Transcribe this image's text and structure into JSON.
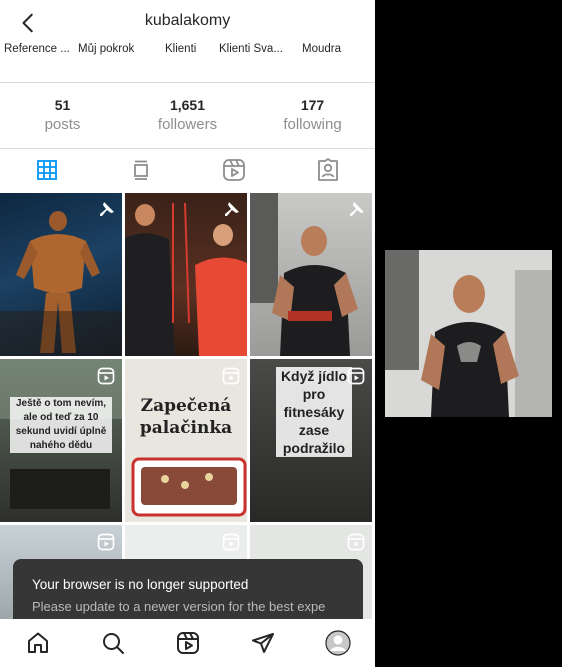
{
  "header": {
    "username": "kubalakomy"
  },
  "highlights": [
    "Reference ...",
    "Můj pokrok",
    "Klienti",
    "Klienti Sva...",
    "Moudra"
  ],
  "stats": [
    {
      "value": "51",
      "label": "posts"
    },
    {
      "value": "1,651",
      "label": "followers"
    },
    {
      "value": "177",
      "label": "following"
    }
  ],
  "tabs": [
    "grid-icon",
    "feed-icon",
    "reels-icon",
    "tagged-icon"
  ],
  "posts": [
    {
      "kind": "pinned",
      "caption": ""
    },
    {
      "kind": "pinned",
      "caption": ""
    },
    {
      "kind": "pinned",
      "caption": ""
    },
    {
      "kind": "reel",
      "caption": "Ještě o tom nevím, ale od teď za 10 sekund uvidí úplně nahého dědu"
    },
    {
      "kind": "reel",
      "caption": "Zapečená palačinka"
    },
    {
      "kind": "reel",
      "caption": "Když jídlo pro fitnesáky zase podražilo"
    },
    {
      "kind": "reel",
      "caption": ""
    },
    {
      "kind": "reel",
      "caption": ""
    },
    {
      "kind": "reel",
      "caption": ""
    }
  ],
  "toast": {
    "title": "Your browser is no longer supported",
    "message": "Please update to a newer version for the best expe"
  },
  "bottom_nav": [
    "home-icon",
    "search-icon",
    "reels-icon",
    "direct-icon",
    "profile-avatar"
  ],
  "colors": {
    "accent": "#0095f6",
    "toast_bg": "#363636",
    "divider": "#dbdbdb"
  }
}
